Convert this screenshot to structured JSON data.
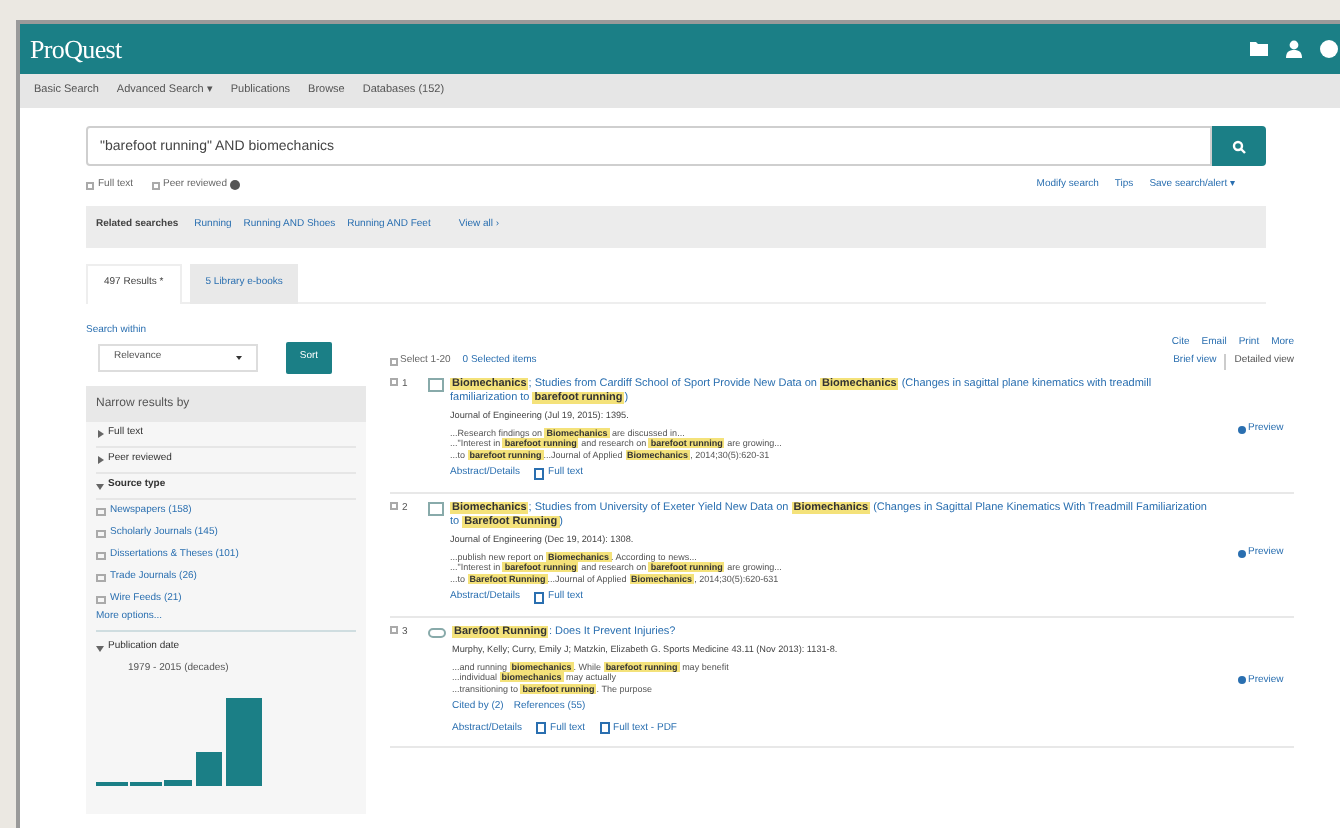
{
  "header": {
    "logo": "ProQuest"
  },
  "nav": [
    "Basic Search",
    "Advanced Search ▾",
    "Publications",
    "Browse",
    "Databases (152)"
  ],
  "search": {
    "value": "\"barefoot running\" AND biomechanics"
  },
  "limits": [
    {
      "label": "Full text",
      "checked": false,
      "info": false
    },
    {
      "label": "Peer reviewed",
      "checked": false,
      "info": true
    }
  ],
  "search_links": [
    "Modify search",
    "Tips",
    "Save search/alert ▾"
  ],
  "related": {
    "label": "Related searches",
    "items": [
      "Running",
      "Running AND Shoes",
      "Running AND Feet"
    ],
    "view_all": "View all ›"
  },
  "tabs": [
    {
      "label": "497 Results *",
      "selected": true
    },
    {
      "label": "5 Library e-books",
      "selected": false
    }
  ],
  "sort": {
    "label": "Search within",
    "value": "Relevance",
    "button": "Sort"
  },
  "facets": {
    "title": "Narrow results by",
    "groups": [
      {
        "label": "Full text",
        "expanded": false
      },
      {
        "label": "Peer reviewed",
        "expanded": false
      },
      {
        "label": "Source type",
        "expanded": true
      }
    ],
    "source_types": [
      "Newspapers (158)",
      "Scholarly Journals (145)",
      "Dissertations & Theses (101)",
      "Trade Journals (26)",
      "Wire Feeds (21)"
    ],
    "more": "More options...",
    "date": {
      "label": "Publication date",
      "range": "1979 - 2015 (decades)"
    }
  },
  "actions": [
    "Cite",
    "Email",
    "Print",
    "More"
  ],
  "select": {
    "label": "Select 1-20",
    "checked": false,
    "selected_items": "0 Selected items"
  },
  "views": [
    {
      "label": "Brief view",
      "selected": false
    },
    {
      "label": "Detailed view",
      "selected": true
    }
  ],
  "results": [
    {
      "number": "1",
      "kind": "article",
      "title": [
        {
          "text": "Biomechanics",
          "hl": true
        },
        {
          "text": "; Studies from Cardiff School of Sport Provide New Data on ",
          "hl": false
        },
        {
          "text": "Biomechanics",
          "hl": true
        },
        {
          "text": " (Changes in sagittal plane kinematics with treadmill familiarization to ",
          "hl": false
        },
        {
          "text": "barefoot running",
          "hl": true
        },
        {
          "text": ")",
          "hl": false
        }
      ],
      "source": "Journal of Engineering (Jul 19, 2015): 1395.",
      "snippets": [
        [
          {
            "text": "...Research findings on ",
            "hl": false
          },
          {
            "text": "Biomechanics",
            "hl": true
          },
          {
            "text": " are discussed in...",
            "hl": false
          }
        ],
        [
          {
            "text": "...\"Interest in ",
            "hl": false
          },
          {
            "text": "barefoot running",
            "hl": true
          },
          {
            "text": " and research on ",
            "hl": false
          },
          {
            "text": "barefoot running",
            "hl": true
          },
          {
            "text": " are growing...",
            "hl": false
          }
        ],
        [
          {
            "text": "...to ",
            "hl": false
          },
          {
            "text": "barefoot running",
            "hl": true
          },
          {
            "text": "...Journal of Applied ",
            "hl": false
          },
          {
            "text": "Biomechanics",
            "hl": true
          },
          {
            "text": ", 2014;30(5):620-31",
            "hl": false
          }
        ]
      ],
      "checked": false,
      "links": [
        {
          "label": "Abstract/Details",
          "icon": false
        },
        {
          "label": "Full text",
          "icon": true
        }
      ],
      "preview": "Preview"
    },
    {
      "number": "2",
      "kind": "article",
      "title": [
        {
          "text": "Biomechanics",
          "hl": true
        },
        {
          "text": "; Studies from University of Exeter Yield New Data on ",
          "hl": false
        },
        {
          "text": "Biomechanics",
          "hl": true
        },
        {
          "text": " (Changes in Sagittal Plane Kinematics With Treadmill Familiarization to ",
          "hl": false
        },
        {
          "text": "Barefoot Running",
          "hl": true
        },
        {
          "text": ")",
          "hl": false
        }
      ],
      "source": "Journal of Engineering (Dec 19, 2014): 1308.",
      "snippets": [
        [
          {
            "text": "...publish new report on ",
            "hl": false
          },
          {
            "text": "Biomechanics",
            "hl": true
          },
          {
            "text": ". According to news...",
            "hl": false
          }
        ],
        [
          {
            "text": "...\"Interest in ",
            "hl": false
          },
          {
            "text": "barefoot running",
            "hl": true
          },
          {
            "text": " and research on ",
            "hl": false
          },
          {
            "text": "barefoot running",
            "hl": true
          },
          {
            "text": " are growing...",
            "hl": false
          }
        ],
        [
          {
            "text": "...to ",
            "hl": false
          },
          {
            "text": "Barefoot Running",
            "hl": true
          },
          {
            "text": "...Journal of Applied ",
            "hl": false
          },
          {
            "text": "Biomechanics",
            "hl": true
          },
          {
            "text": ", 2014;30(5):620-631",
            "hl": false
          }
        ]
      ],
      "checked": false,
      "links": [
        {
          "label": "Abstract/Details",
          "icon": false
        },
        {
          "label": "Full text",
          "icon": true
        }
      ],
      "preview": "Preview"
    },
    {
      "number": "3",
      "kind": "journal",
      "title": [
        {
          "text": "Barefoot Running",
          "hl": true
        },
        {
          "text": ": Does It Prevent Injuries?",
          "hl": false
        }
      ],
      "source": "Murphy, Kelly; Curry, Emily J; Matzkin, Elizabeth G. Sports Medicine 43.11 (Nov 2013): 1131-8.",
      "snippets": [
        [
          {
            "text": "...and running ",
            "hl": false
          },
          {
            "text": "biomechanics",
            "hl": true
          },
          {
            "text": ". While ",
            "hl": false
          },
          {
            "text": "barefoot running",
            "hl": true
          },
          {
            "text": " may benefit",
            "hl": false
          }
        ],
        [
          {
            "text": "...individual ",
            "hl": false
          },
          {
            "text": "biomechanics",
            "hl": true
          },
          {
            "text": " may actually",
            "hl": false
          }
        ],
        [
          {
            "text": "...transitioning to ",
            "hl": false
          },
          {
            "text": "barefoot running",
            "hl": true
          },
          {
            "text": ". The purpose",
            "hl": false
          }
        ]
      ],
      "citations": [
        "Cited by (2)",
        "References (55)"
      ],
      "checked": false,
      "links": [
        {
          "label": "Abstract/Details",
          "icon": false
        },
        {
          "label": "Full text",
          "icon": true
        },
        {
          "label": "Full text - PDF",
          "icon": true
        }
      ],
      "preview": "Preview"
    }
  ]
}
